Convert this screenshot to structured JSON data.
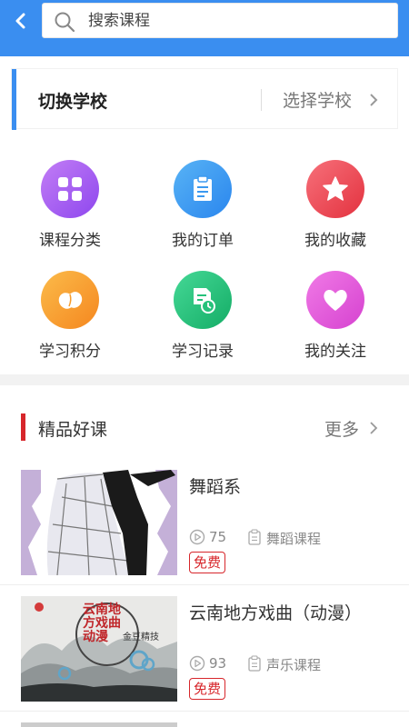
{
  "header": {
    "search_placeholder": "搜索课程",
    "accent": "#3a8ef0"
  },
  "school": {
    "title": "切换学校",
    "select_label": "选择学校"
  },
  "grid": [
    {
      "label": "课程分类",
      "icon": "grid-icon",
      "color": "#a35ff0"
    },
    {
      "label": "我的订单",
      "icon": "clipboard-icon",
      "color": "#3b99f0"
    },
    {
      "label": "我的收藏",
      "icon": "star-icon",
      "color": "#ef4c57"
    },
    {
      "label": "学习积分",
      "icon": "bean-icon",
      "color": "#f79d2d"
    },
    {
      "label": "学习记录",
      "icon": "record-icon",
      "color": "#26c27b"
    },
    {
      "label": "我的关注",
      "icon": "heart-icon",
      "color": "#e25bd8"
    }
  ],
  "section": {
    "title": "精品好课",
    "more": "更多"
  },
  "courses": [
    {
      "title": "舞蹈系",
      "count": "75",
      "category": "舞蹈课程",
      "badge": "免费"
    },
    {
      "title": "云南地方戏曲（动漫）",
      "count": "93",
      "category": "声乐课程",
      "badge": "免费"
    }
  ],
  "thumb_text": {
    "c2_poster_main": "云南地方戏曲动漫",
    "c2_poster_side": "金豆精技"
  }
}
